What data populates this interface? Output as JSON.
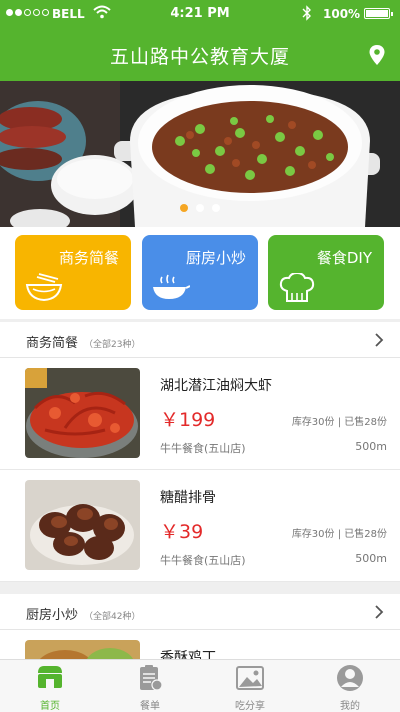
{
  "status_bar": {
    "carrier": "BELL",
    "time": "4:21 PM",
    "battery": "100%"
  },
  "header": {
    "title": "五山路中公教育大厦",
    "location_icon": "location-pin-icon"
  },
  "banner": {
    "slide_count": 3,
    "active_slide": 1
  },
  "categories": [
    {
      "label": "商务简餐",
      "icon": "bowl-icon",
      "color": "#f8b500"
    },
    {
      "label": "厨房小炒",
      "icon": "stir-fry-icon",
      "color": "#4a8ee8"
    },
    {
      "label": "餐食DIY",
      "icon": "chef-hat-icon",
      "color": "#55b42e"
    }
  ],
  "sections": [
    {
      "title": "商务简餐",
      "count": "（全部23种）",
      "items": [
        {
          "name": "湖北潜江油焖大虾",
          "price": "￥199",
          "stats": "库存30份 | 已售28份",
          "shop": "牛牛餐食(五山店)",
          "distance": "500m"
        },
        {
          "name": "糖醋排骨",
          "price": "￥39",
          "stats": "库存30份 | 已售28份",
          "shop": "牛牛餐食(五山店)",
          "distance": "500m"
        }
      ]
    },
    {
      "title": "厨房小炒",
      "count": "（全部42种）",
      "items": [
        {
          "name": "香酥鸡丁"
        }
      ]
    }
  ],
  "tabbar": [
    {
      "label": "首页",
      "icon": "home-shop-icon",
      "active": true
    },
    {
      "label": "餐单",
      "icon": "menu-list-icon",
      "active": false
    },
    {
      "label": "吃分享",
      "icon": "photo-share-icon",
      "active": false
    },
    {
      "label": "我的",
      "icon": "user-profile-icon",
      "active": false
    }
  ],
  "colors": {
    "brand_green": "#55b42e",
    "price_red": "#e32a2a",
    "dot_active": "#f5a623"
  }
}
